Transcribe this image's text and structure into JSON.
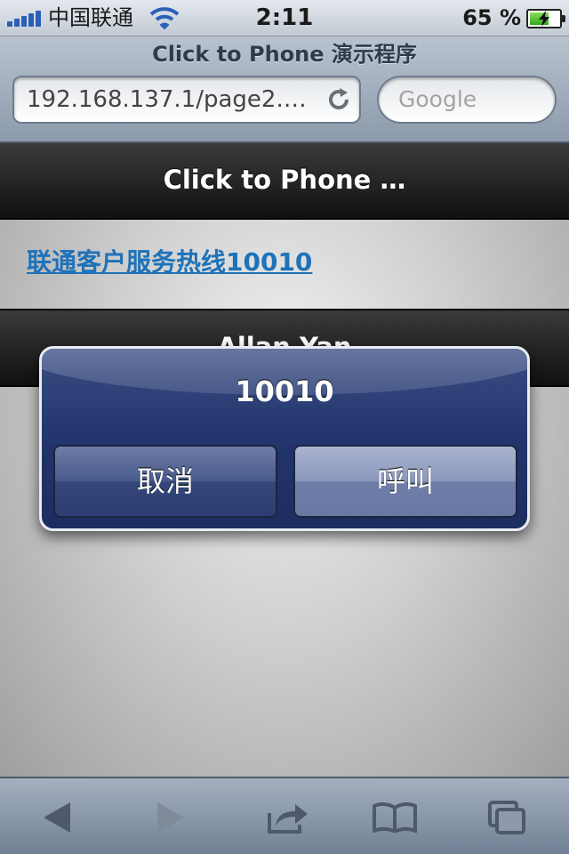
{
  "status_bar": {
    "carrier": "中国联通",
    "time": "2:11",
    "battery_percent": "65 %",
    "battery_level": 0.65
  },
  "safari": {
    "page_title": "Click to Phone 演示程序",
    "url": "192.168.137.1/page2.…",
    "search_placeholder": "Google"
  },
  "page": {
    "header_title": "Click to Phone …",
    "hotline_link": "联通客户服务热线10010",
    "footer_title": "Allan Yan"
  },
  "alert": {
    "title": "10010",
    "cancel_label": "取消",
    "call_label": "呼叫"
  },
  "toolbar": {
    "icons": [
      "back-icon",
      "forward-icon",
      "share-icon",
      "bookmarks-icon",
      "tabs-icon"
    ]
  },
  "colors": {
    "link": "#1e72b8",
    "alert_bg": "#22356c",
    "header_bar": "#1a1a1a"
  }
}
